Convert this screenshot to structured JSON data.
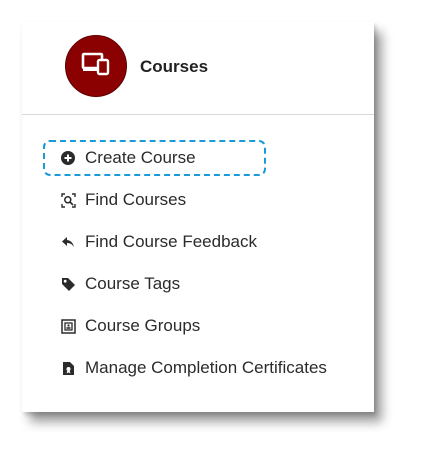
{
  "header": {
    "title": "Courses",
    "icon": "devices-icon",
    "icon_bg": "#8b0000"
  },
  "menu": {
    "items": [
      {
        "label": "Create Course",
        "icon": "plus-circle-icon",
        "focused": true
      },
      {
        "label": "Find Courses",
        "icon": "search-document-icon"
      },
      {
        "label": "Find Course Feedback",
        "icon": "reply-arrow-icon"
      },
      {
        "label": "Course Tags",
        "icon": "tag-icon"
      },
      {
        "label": "Course Groups",
        "icon": "group-frame-icon"
      },
      {
        "label": "Manage Completion Certificates",
        "icon": "certificate-file-icon"
      }
    ],
    "focus_color": "#1a9bd7"
  }
}
